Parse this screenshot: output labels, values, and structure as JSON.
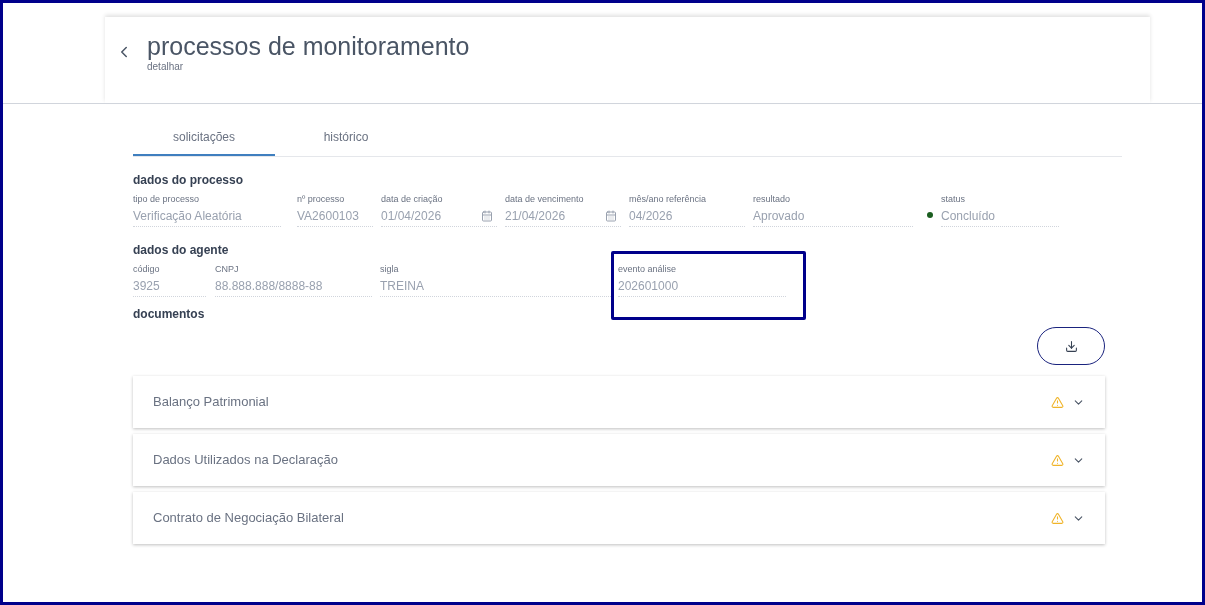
{
  "header": {
    "title": "processos de monitoramento",
    "subtitle": "detalhar"
  },
  "tabs": [
    {
      "label": "solicitações",
      "selected": true
    },
    {
      "label": "histórico",
      "selected": false
    }
  ],
  "process": {
    "heading": "dados do processo",
    "fields": [
      {
        "kind": "text",
        "label": "tipo de processo",
        "value": "Verificação Aleatória"
      },
      {
        "kind": "text",
        "label": "nº processo",
        "value": "VA2600103"
      },
      {
        "kind": "date",
        "label": "data de criação",
        "value": "01/04/2026"
      },
      {
        "kind": "date",
        "label": "data de vencimento",
        "value": "21/04/2026"
      },
      {
        "kind": "text",
        "label": "mês/ano referência",
        "value": "04/2026"
      },
      {
        "kind": "text",
        "label": "resultado",
        "value": "Aprovado"
      },
      {
        "kind": "status",
        "label": "status",
        "value": "Concluído",
        "color": "#1b5e20"
      }
    ]
  },
  "agent": {
    "heading": "dados do agente",
    "fields": [
      {
        "kind": "text",
        "label": "código",
        "value": "3925"
      },
      {
        "kind": "text",
        "label": "CNPJ",
        "value": "88.888.888/8888-88"
      },
      {
        "kind": "text",
        "label": "sigla",
        "value": "TREINA"
      },
      {
        "kind": "text",
        "label": "evento análise",
        "value": "202601000",
        "highlighted": true
      }
    ]
  },
  "documents": {
    "heading": "documentos",
    "items": [
      {
        "title": "Balanço Patrimonial",
        "warning": true,
        "expanded": false
      },
      {
        "title": "Dados Utilizados na Declaração",
        "warning": true,
        "expanded": false
      },
      {
        "title": "Contrato de Negociação Bilateral",
        "warning": true,
        "expanded": false
      }
    ]
  }
}
